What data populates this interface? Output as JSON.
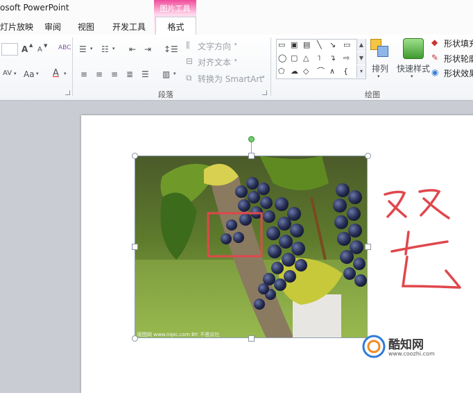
{
  "window": {
    "title": "osoft PowerPoint"
  },
  "tabs": [
    {
      "label": "灯片放映"
    },
    {
      "label": "审阅"
    },
    {
      "label": "视图"
    },
    {
      "label": "开发工具"
    }
  ],
  "contextual_tab": {
    "group_label": "图片工具",
    "tab_label": "格式"
  },
  "ribbon": {
    "font": {
      "grow_font": "A",
      "shrink_font": "A",
      "clear_format": "ABC",
      "char_spacing": "AV",
      "change_case": "Aa",
      "font_color": "A"
    },
    "paragraph": {
      "text_direction": "文字方向",
      "align_text": "对齐文本",
      "convert_smartart": "转换为 SmartArt",
      "group_label": "段落"
    },
    "drawing": {
      "arrange": "排列",
      "quick_styles": "快速样式",
      "shape_fill": "形状填充",
      "shape_outline": "形状轮廓",
      "shape_effects": "形状效果",
      "group_label": "绘图"
    }
  },
  "annotation": {
    "handwritten_text": "双击",
    "color": "#e0474c"
  },
  "image_watermark": "昵图网 www.nipic.com   BY: 不思议社",
  "brand": {
    "name": "酷知网",
    "url": "www.coozhi.com"
  },
  "colors": {
    "picture_tools_accent": "#f04c9b",
    "selection_rect": "#e0474c"
  }
}
